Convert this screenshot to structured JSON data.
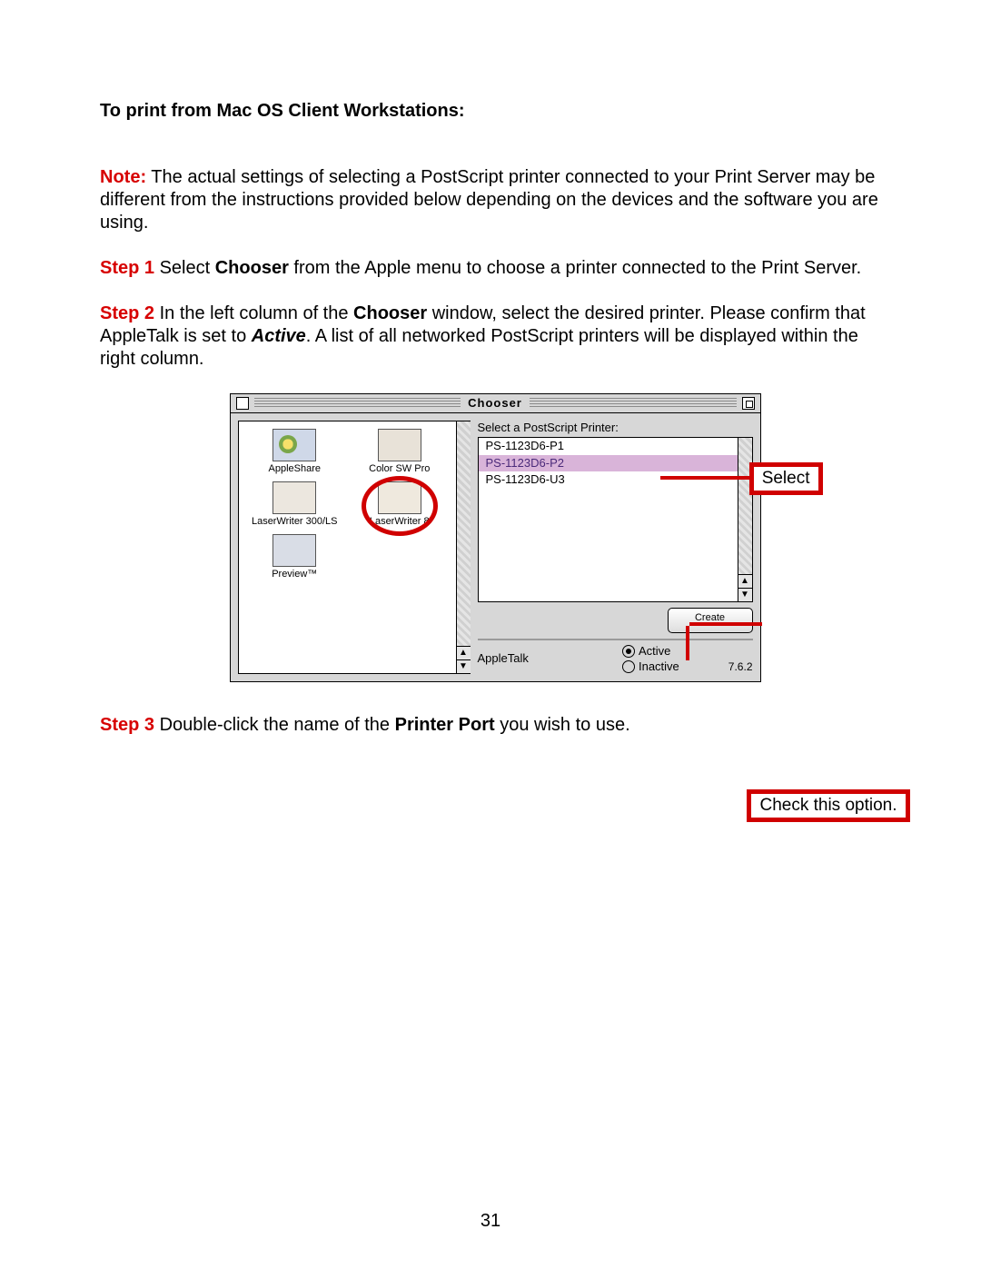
{
  "heading": "To print from Mac OS Client Workstations:",
  "note": {
    "label": "Note:",
    "text": " The actual settings of selecting a PostScript printer connected to your Print Server may be different from the instructions provided below depending on the devices and the software you are using."
  },
  "step1": {
    "label": "Step 1",
    "pre": " Select ",
    "b1": "Chooser",
    "post": " from the Apple menu to choose a printer connected to the Print Server."
  },
  "step2": {
    "label": "Step 2",
    "pre": " In the left column of the ",
    "b1": "Chooser",
    "mid": " window, select the desired printer.  Please confirm that AppleTalk is set to ",
    "b2": "Active",
    "post": ".  A list of all networked PostScript printers will be displayed within the right column."
  },
  "step3": {
    "label": "Step 3",
    "pre": " Double-click the name of the ",
    "b1": "Printer Port",
    "post": " you wish to use."
  },
  "chooser": {
    "title": "Chooser",
    "drivers": {
      "appleshare": "AppleShare",
      "colorsw": "Color SW Pro",
      "lw300": "LaserWriter 300/LS",
      "lw8": "LaserWriter 8",
      "preview": "Preview™"
    },
    "listLabel": "Select a PostScript Printer:",
    "printers": [
      "PS-1123D6-P1",
      "PS-1123D6-P2",
      "PS-1123D6-U3"
    ],
    "createBtn": "Create",
    "atLabel": "AppleTalk",
    "atActive": "Active",
    "atInactive": "Inactive",
    "version": "7.6.2"
  },
  "annotations": {
    "select": "Select",
    "check": "Check this option."
  },
  "pageNumber": "31"
}
